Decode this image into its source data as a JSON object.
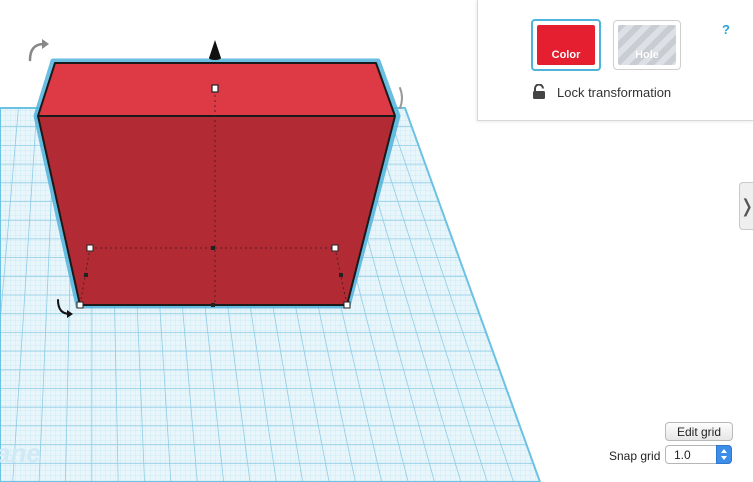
{
  "inspector": {
    "color_label": "Color",
    "hole_label": "Hole",
    "help_label": "?",
    "lock_label": "Lock transformation"
  },
  "workplane": {
    "label": "ane"
  },
  "grid": {
    "edit_label": "Edit grid",
    "snap_label": "Snap grid",
    "snap_value": "1.0"
  },
  "colors": {
    "shape_front": "#b22b34",
    "shape_top": "#dd3a45",
    "color_swatch": "#e51f2f",
    "grid_blue": "#4fb3dc",
    "accent": "#2aa3d6"
  },
  "icons": {
    "lock": "lock-icon",
    "chevron": "chevron-right-icon",
    "rotate": "rotate-arrow-icon",
    "cone": "lift-cone-icon"
  }
}
